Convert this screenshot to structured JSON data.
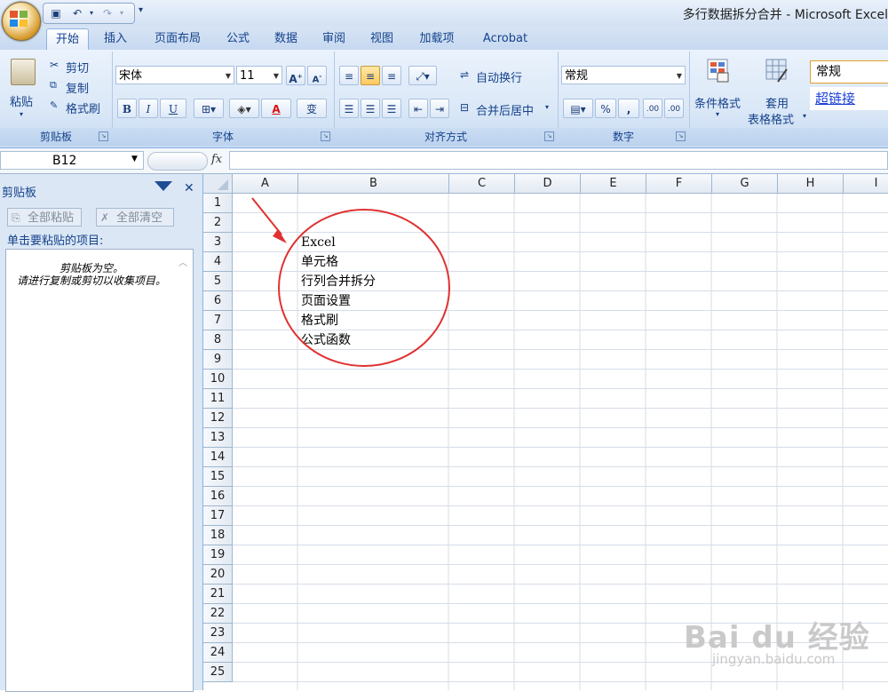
{
  "window": {
    "title": "多行数据拆分合并 - Microsoft Excel"
  },
  "tabs": [
    "开始",
    "插入",
    "页面布局",
    "公式",
    "数据",
    "审阅",
    "视图",
    "加载项",
    "Acrobat"
  ],
  "ribbon": {
    "clipboard": {
      "paste": "粘贴",
      "cut": "剪切",
      "copy": "复制",
      "format_painter": "格式刷",
      "label": "剪贴板"
    },
    "font": {
      "name": "宋体",
      "size": "11",
      "bold": "B",
      "italic": "I",
      "underline": "U",
      "font_color": "A",
      "phonetic": "变",
      "label": "字体"
    },
    "alignment": {
      "wrap_text": "自动换行",
      "merge_center": "合并后居中",
      "label": "对齐方式"
    },
    "number": {
      "format": "常规",
      "percent": "%",
      "comma": ",",
      "inc_decimal": ".00",
      "dec_decimal": ".00",
      "label": "数字"
    },
    "styles": {
      "conditional": "条件格式",
      "table_a": "套用",
      "table_b": "表格格式",
      "style_normal": "常规",
      "style_hyperlink": "超链接"
    }
  },
  "formula_bar": {
    "name_box": "B12",
    "fx": "fx",
    "value": ""
  },
  "clipboard_pane": {
    "title": "剪贴板",
    "paste_all": "全部粘贴",
    "clear_all": "全部清空",
    "hint": "单击要粘贴的项目:",
    "empty_line1": "剪贴板为空。",
    "empty_line2": "请进行复制或剪切以收集项目。"
  },
  "grid": {
    "columns": [
      "A",
      "B",
      "C",
      "D",
      "E",
      "F",
      "G",
      "H",
      "I"
    ],
    "rows": [
      "1",
      "2",
      "3",
      "4",
      "5",
      "6",
      "7",
      "8",
      "9",
      "10",
      "11",
      "12",
      "13",
      "14",
      "15",
      "16",
      "17",
      "18",
      "19",
      "20",
      "21",
      "22",
      "23",
      "24",
      "25"
    ],
    "cells_b": [
      "Excel",
      "单元格",
      "行列合并拆分",
      "页面设置",
      "格式刷",
      "公式函数"
    ],
    "annotation_color": "#e03131"
  },
  "watermark": {
    "logo": "Bai du 经验",
    "url": "jingyan.baidu.com"
  }
}
